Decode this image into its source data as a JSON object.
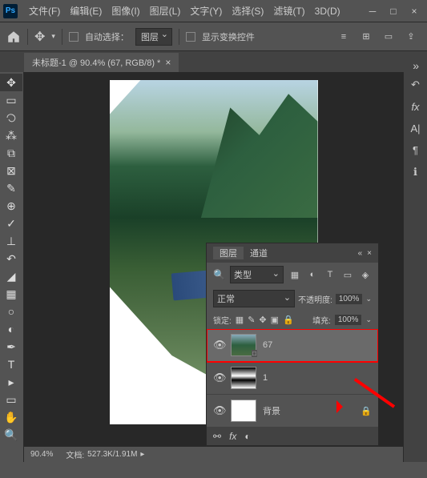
{
  "menu": {
    "file": "文件(F)",
    "edit": "编辑(E)",
    "image": "图像(I)",
    "layer": "图层(L)",
    "type": "文字(Y)",
    "select": "选择(S)",
    "filter": "滤镜(T)",
    "threed": "3D(D)"
  },
  "options": {
    "auto_select": "自动选择：",
    "target": "图层",
    "show_transform": "显示变换控件"
  },
  "doc": {
    "tab_title": "未标题-1 @ 90.4% (67, RGB/8) *"
  },
  "status": {
    "zoom": "90.4%",
    "filesize_label": "文档:",
    "filesize": "527.3K/1.91M"
  },
  "layers_panel": {
    "tab_layers": "图层",
    "tab_channels": "通道",
    "type_label": "类型",
    "blend_mode": "正常",
    "opacity_label": "不透明度:",
    "opacity_value": "100%",
    "lock_label": "锁定:",
    "fill_label": "填充:",
    "fill_value": "100%",
    "layers": [
      {
        "name": "67",
        "visible": true,
        "selected": true,
        "thumb": "photo"
      },
      {
        "name": "1",
        "visible": true,
        "selected": false,
        "thumb": "brush"
      },
      {
        "name": "背景",
        "visible": true,
        "selected": false,
        "thumb": "white",
        "locked": true
      }
    ]
  }
}
